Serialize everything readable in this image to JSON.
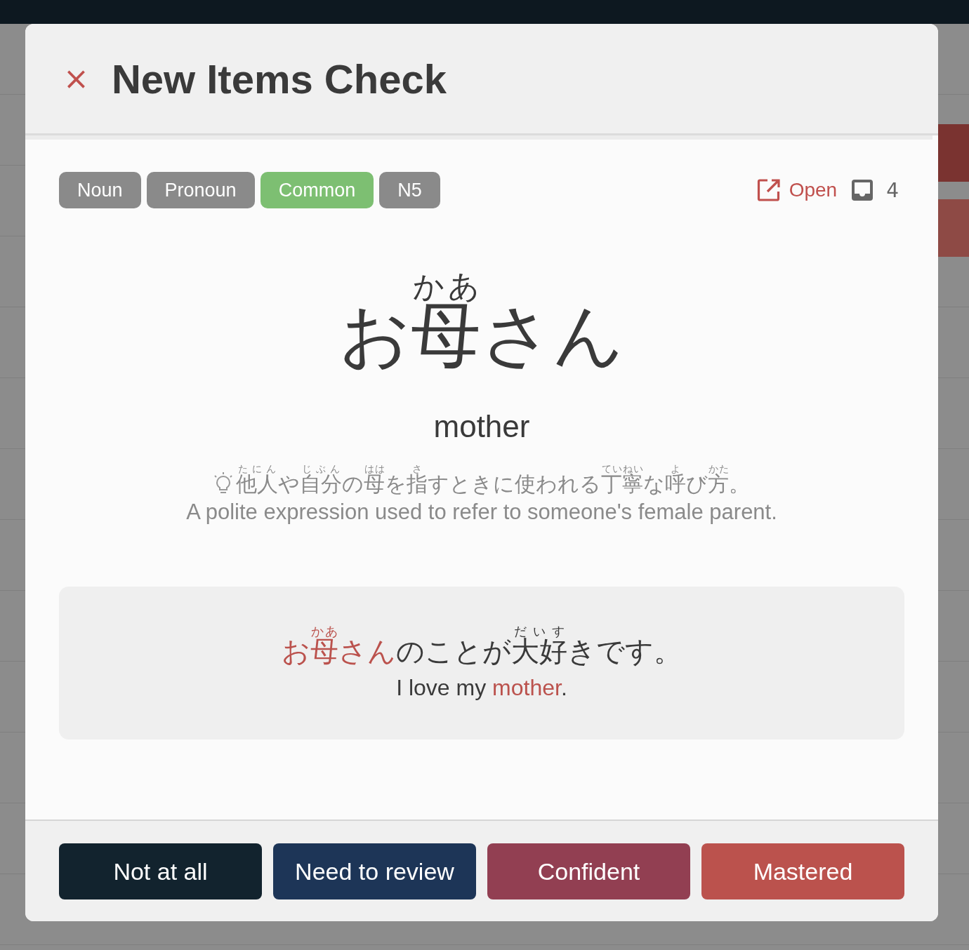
{
  "dialog": {
    "title": "New Items Check",
    "close_icon": "×"
  },
  "tags": [
    {
      "label": "Noun",
      "color": "#8a8a8a"
    },
    {
      "label": "Pronoun",
      "color": "#8a8a8a"
    },
    {
      "label": "Common",
      "color": "#7dbf72"
    },
    {
      "label": "N5",
      "color": "#8a8a8a"
    }
  ],
  "open_link": "Open",
  "review_count": "4",
  "word": [
    {
      "text": "お"
    },
    {
      "text": "母",
      "reading": "かあ"
    },
    {
      "text": "さん"
    }
  ],
  "meaning": "mother",
  "definition": [
    {
      "text": "他人",
      "reading": "たにん"
    },
    {
      "text": "や"
    },
    {
      "text": "自分",
      "reading": "じぶん"
    },
    {
      "text": "の"
    },
    {
      "text": "母",
      "reading": "はは"
    },
    {
      "text": "を"
    },
    {
      "text": "指",
      "reading": "さ"
    },
    {
      "text": "すときに使われる"
    },
    {
      "text": "丁寧",
      "reading": "ていねい"
    },
    {
      "text": "な"
    },
    {
      "text": "呼",
      "reading": "よ"
    },
    {
      "text": "び"
    },
    {
      "text": "方",
      "reading": "かた"
    },
    {
      "text": "。"
    }
  ],
  "definition_translation": "A polite expression used to refer to someone's female parent.",
  "example": {
    "sentence": [
      {
        "text": "お",
        "highlight": true
      },
      {
        "text": "母",
        "reading": "かあ",
        "highlight": true
      },
      {
        "text": "さん",
        "highlight": true
      },
      {
        "text": "のことが",
        "highlight": false
      },
      {
        "text": "大好",
        "reading": "だいす",
        "highlight": false
      },
      {
        "text": "きです。",
        "highlight": false
      }
    ],
    "translation": [
      {
        "text": "I love my ",
        "highlight": false
      },
      {
        "text": "mother",
        "highlight": true
      },
      {
        "text": ".",
        "highlight": false
      }
    ]
  },
  "buttons": [
    {
      "label": "Not at all",
      "color": "#12232e"
    },
    {
      "label": "Need to review",
      "color": "#1d3557"
    },
    {
      "label": "Confident",
      "color": "#923f52"
    },
    {
      "label": "Mastered",
      "color": "#bb524d"
    }
  ]
}
